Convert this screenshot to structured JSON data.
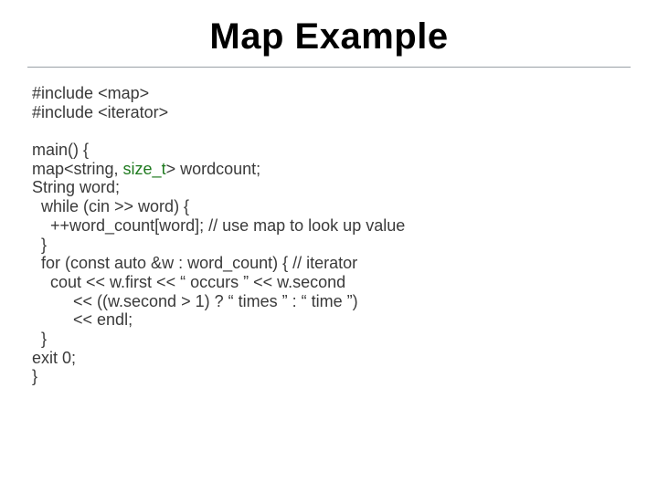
{
  "title": "Map Example",
  "code": {
    "inc1a": "#include",
    "inc1b": " <map>",
    "inc2a": "#include",
    "inc2b": " <iterator>",
    "blank": "",
    "l1": "main() {",
    "l2a": "map<string, ",
    "l2b": "size_t",
    "l2c": "> wordcount;",
    "l3": "String word;",
    "l4": "  while (cin >> word) {",
    "l5": "    ++word_count[word]; // use map to look up value",
    "l6": "  }",
    "l7": "  for (const auto &w : word_count) { // iterator",
    "l8": "    cout << w.first << “ occurs ” << w.second",
    "l9": "         << ((w.second > 1) ? “ times ” : “ time ”)",
    "l10": "         << endl;",
    "l11": "  }",
    "l12": "exit 0;",
    "l13": "}"
  }
}
